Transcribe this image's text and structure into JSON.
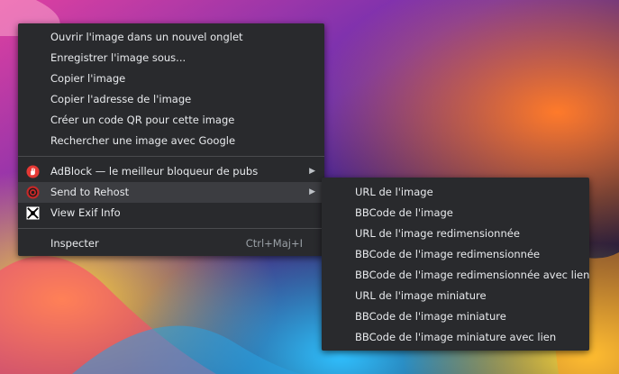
{
  "main_menu": {
    "items": [
      {
        "label": "Ouvrir l'image dans un nouvel onglet"
      },
      {
        "label": "Enregistrer l'image sous..."
      },
      {
        "label": "Copier l'image"
      },
      {
        "label": "Copier l'adresse de l'image"
      },
      {
        "label": "Créer un code QR pour cette image"
      },
      {
        "label": "Rechercher une image avec Google"
      }
    ],
    "ext_items": [
      {
        "label": "AdBlock — le meilleur bloqueur de pubs",
        "icon": "adblock-hand-icon"
      },
      {
        "label": "Send to Rehost",
        "icon": "rehost-icon"
      },
      {
        "label": "View Exif Info",
        "icon": "exif-icon"
      }
    ],
    "inspect": {
      "label": "Inspecter",
      "shortcut": "Ctrl+Maj+I"
    }
  },
  "sub_menu": {
    "items": [
      {
        "label": "URL de l'image"
      },
      {
        "label": "BBCode de l'image"
      },
      {
        "label": "URL de l'image redimensionnée"
      },
      {
        "label": "BBCode de l'image redimensionnée"
      },
      {
        "label": "BBCode de l'image redimensionnée avec lien"
      },
      {
        "label": "URL de l'image miniature"
      },
      {
        "label": "BBCode de l'image miniature"
      },
      {
        "label": "BBCode de l'image miniature avec lien"
      }
    ]
  },
  "colors": {
    "menu_bg": "#292a2d",
    "highlight": "#3c3d41",
    "text": "#e8eaed"
  }
}
